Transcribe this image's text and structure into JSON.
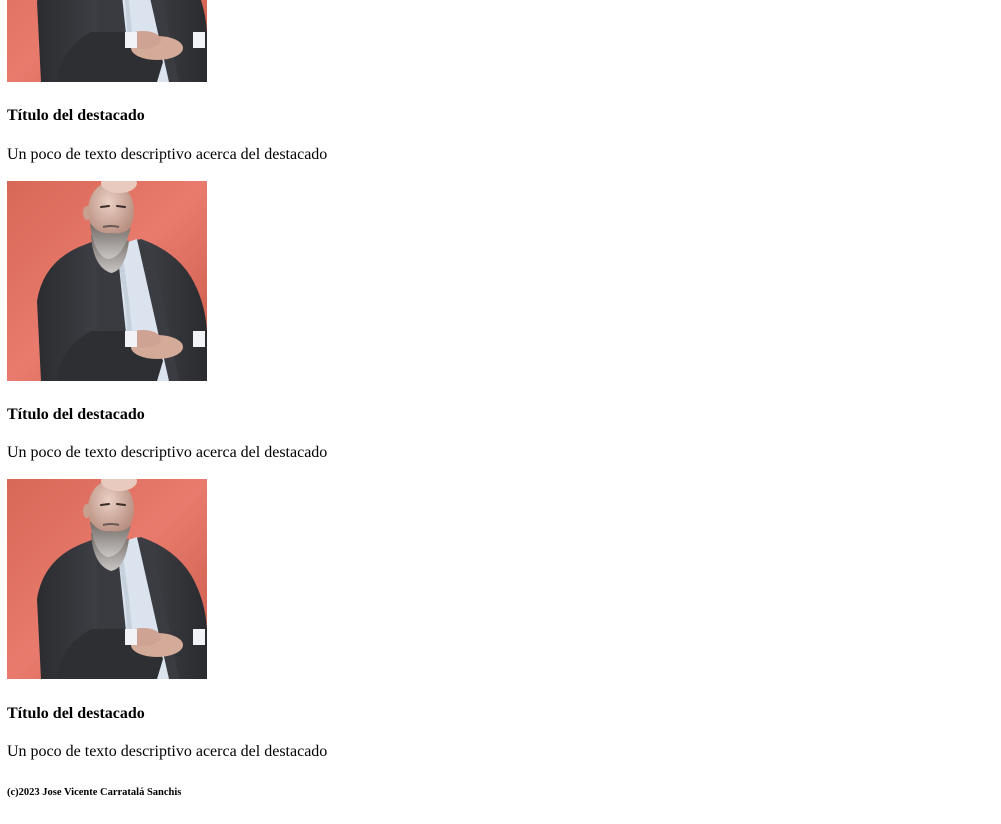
{
  "features": [
    {
      "image_alt": "portrait photo",
      "title": "Título del destacado",
      "text": "Un poco de texto descriptivo acerca del destacado"
    },
    {
      "image_alt": "portrait photo",
      "title": "Título del destacado",
      "text": "Un poco de texto descriptivo acerca del destacado"
    },
    {
      "image_alt": "portrait photo",
      "title": "Título del destacado",
      "text": "Un poco de texto descriptivo acerca del destacado"
    }
  ],
  "footer": {
    "copyright": "(c)2023 Jose Vicente Carratalá Sanchis"
  },
  "colors": {
    "photo_background": "#e27466",
    "jacket": "#34353a",
    "shirt": "#dbe3ee",
    "skin": "#d9b3a2",
    "beard": "#9c9794",
    "chair": "#b46a3a"
  }
}
